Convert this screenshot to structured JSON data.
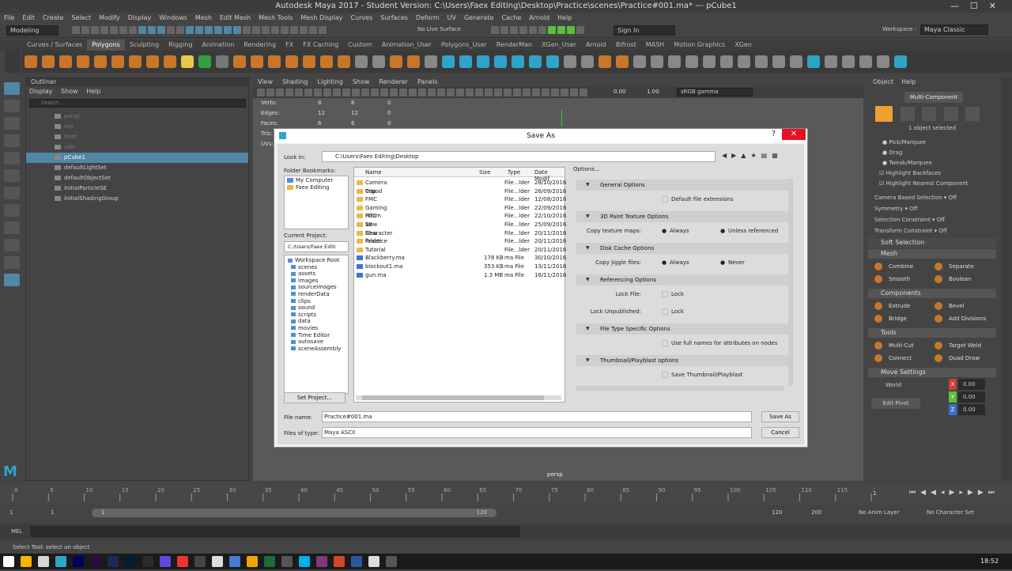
{
  "window": {
    "title": "Autodesk Maya 2017 - Student Version: C:\\Users\\Faex Editing\\Desktop\\Practice\\scenes\\Practice#001.ma*  ---  pCube1",
    "controls": [
      "—",
      "☐",
      "✕"
    ]
  },
  "menubar": [
    "File",
    "Edit",
    "Create",
    "Select",
    "Modify",
    "Display",
    "Windows",
    "Mesh",
    "Edit Mesh",
    "Mesh Tools",
    "Mesh Display",
    "Curves",
    "Surfaces",
    "Deform",
    "UV",
    "Generate",
    "Cache",
    "Arnold",
    "Help"
  ],
  "workspace": {
    "label": "Workspace :",
    "value": "Maya Classic"
  },
  "status": {
    "mode": "Modeling",
    "live": "No Live Surface",
    "signin": "Sign In"
  },
  "shelf_tabs": [
    "Curves / Surfaces",
    "Polygons",
    "Sculpting",
    "Rigging",
    "Animation",
    "Rendering",
    "FX",
    "FX Caching",
    "Custom",
    "Animation_User",
    "Polygons_User",
    "RenderMan",
    "XGen_User",
    "Arnold",
    "Bifrost",
    "MASH",
    "Motion Graphics",
    "XGen"
  ],
  "shelf_active": "Polygons",
  "outliner": {
    "title": "Outliner",
    "menu": [
      "Display",
      "Show",
      "Help"
    ],
    "search_placeholder": "Search...",
    "items": [
      {
        "label": "persp",
        "state": "dim"
      },
      {
        "label": "top",
        "state": "dim"
      },
      {
        "label": "front",
        "state": "dim"
      },
      {
        "label": "side",
        "state": "dim"
      },
      {
        "label": "pCube1",
        "state": "sel"
      },
      {
        "label": "defaultLightSet",
        "state": ""
      },
      {
        "label": "defaultObjectSet",
        "state": ""
      },
      {
        "label": "initialParticleSE",
        "state": ""
      },
      {
        "label": "initialShadingGroup",
        "state": ""
      }
    ]
  },
  "viewport": {
    "menu": [
      "View",
      "Shading",
      "Lighting",
      "Show",
      "Renderer",
      "Panels"
    ],
    "exposure": "0.00",
    "gamma": "1.00",
    "colorspace": "sRGB gamma",
    "hud": [
      {
        "label": "Verts:",
        "a": "8",
        "b": "8",
        "c": "0"
      },
      {
        "label": "Edges:",
        "a": "12",
        "b": "12",
        "c": "0"
      },
      {
        "label": "Faces:",
        "a": "6",
        "b": "6",
        "c": "0"
      },
      {
        "label": "Tris:",
        "a": "",
        "b": "",
        "c": ""
      },
      {
        "label": "UVs:",
        "a": "",
        "b": "",
        "c": ""
      }
    ],
    "camera": "persp"
  },
  "dialog": {
    "title": "Save As",
    "look_in_label": "Look in:",
    "look_in": "C:\\Users\\Faex Editing\\Desktop",
    "bookmarks_label": "Folder Bookmarks:",
    "bookmarks": [
      "My Computer",
      "Faex Editing"
    ],
    "project_label": "Current Project:",
    "project": "C:/Users/Faex Editi",
    "project_tree": [
      "Workspace Root",
      "scenes",
      "assets",
      "images",
      "sourceimages",
      "renderData",
      "clips",
      "sound",
      "scripts",
      "data",
      "movies",
      "Time Editor",
      "autosave",
      "sceneAssembly"
    ],
    "set_project": "Set Project...",
    "columns": [
      "Name",
      "Size",
      "Type",
      "Date Modif"
    ],
    "files": [
      {
        "name": "Camera Tripod",
        "size": "",
        "type": "File...lder",
        "date": "28/10/2016",
        "kind": "folder"
      },
      {
        "name": "Cop",
        "size": "",
        "type": "File...lder",
        "date": "26/09/2016",
        "kind": "folder"
      },
      {
        "name": "FMC",
        "size": "",
        "type": "File...lder",
        "date": "12/08/2016",
        "kind": "folder"
      },
      {
        "name": "Gaming Room",
        "size": "",
        "type": "File...lder",
        "date": "22/09/2016",
        "kind": "folder"
      },
      {
        "name": "HTC 10",
        "size": "",
        "type": "File...lder",
        "date": "22/10/2016",
        "kind": "folder"
      },
      {
        "name": "New Character",
        "size": "",
        "type": "File...lder",
        "date": "25/09/2016",
        "kind": "folder"
      },
      {
        "name": "New folder",
        "size": "",
        "type": "File...lder",
        "date": "20/11/2016",
        "kind": "folder"
      },
      {
        "name": "Practice",
        "size": "",
        "type": "File...lder",
        "date": "20/11/2016",
        "kind": "folder"
      },
      {
        "name": "Tutorial",
        "size": "",
        "type": "File...lder",
        "date": "20/11/2016",
        "kind": "folder"
      },
      {
        "name": "Blackberry.ma",
        "size": "178 KB",
        "type": "ma File",
        "date": "30/10/2016",
        "kind": "file"
      },
      {
        "name": "blockout1.ma",
        "size": "353 KB",
        "type": "ma File",
        "date": "13/11/2016",
        "kind": "file"
      },
      {
        "name": "gun.ma",
        "size": "1.3 MB",
        "type": "ma File",
        "date": "16/11/2016",
        "kind": "file"
      }
    ],
    "options_label": "Options...",
    "sections": [
      {
        "title": "General Options",
        "rows": [
          {
            "text": "Default file extensions",
            "kind": "check"
          }
        ]
      },
      {
        "title": "3D Paint Texture Options",
        "rows": [
          {
            "text": "Copy texture maps:",
            "opt1": "Always",
            "opt2": "Unless referenced",
            "kind": "radio"
          }
        ]
      },
      {
        "title": "Disk Cache Options",
        "rows": [
          {
            "text": "Copy jiggle files:",
            "opt1": "Always",
            "opt2": "Never",
            "kind": "radio"
          }
        ]
      },
      {
        "title": "Referencing Options",
        "rows": [
          {
            "text": "Lock File:",
            "opt1": "Lock",
            "kind": "lock"
          },
          {
            "text": "Lock Unpublished:",
            "opt1": "Lock",
            "kind": "lock"
          }
        ]
      },
      {
        "title": "File Type Specific Options",
        "rows": [
          {
            "text": "Use full names for attributes on nodes",
            "kind": "check"
          }
        ]
      },
      {
        "title": "Thumbnail/Playblast options",
        "rows": [
          {
            "text": "Save Thumbnail/Playblast",
            "kind": "check"
          }
        ]
      }
    ],
    "file_name_label": "File name:",
    "file_name": "Practice#001.ma",
    "file_type_label": "Files of type:",
    "file_type": "Maya ASCII",
    "save_btn": "Save As",
    "cancel_btn": "Cancel"
  },
  "right_panel": {
    "tabs": [
      "Object",
      "Help"
    ],
    "mode": "Multi-Component",
    "selected": "1 object selected",
    "pick_options": [
      "Pick/Marquee",
      "Drag",
      "Tweak/Marquee"
    ],
    "checks": [
      "Highlight Backfaces",
      "Highlight Nearest Component"
    ],
    "camera_sel": {
      "label": "Camera Based Selection",
      "value": "Off"
    },
    "symmetry": {
      "label": "Symmetry",
      "value": "Off"
    },
    "sel_constraint": {
      "label": "Selection Constraint",
      "value": "Off"
    },
    "transform_constraint": {
      "label": "Transform Constraint",
      "value": "Off"
    },
    "soft": "Soft Selection",
    "mesh_title": "Mesh",
    "mesh_btns": [
      "Combine",
      "Separate",
      "Smooth",
      "Boolean"
    ],
    "comp_title": "Components",
    "comp_btns": [
      "Extrude",
      "Bevel",
      "Bridge",
      "Add Divisions"
    ],
    "tools_title": "Tools",
    "tools_btns": [
      "Multi-Cut",
      "Target Weld",
      "Connect",
      "Quad Draw"
    ],
    "move_title": "Move Settings",
    "world": "World",
    "edit_pivot": "Edit Pivot",
    "xyz": [
      {
        "axis": "X",
        "val": "0.00",
        "color": "#d13b3b"
      },
      {
        "axis": "Y",
        "val": "0.00",
        "color": "#5dbf3a"
      },
      {
        "axis": "Z",
        "val": "0.00",
        "color": "#3b6fd1"
      }
    ]
  },
  "timeline": {
    "ticks": [
      "0",
      "5",
      "10",
      "15",
      "20",
      "25",
      "30",
      "35",
      "40",
      "45",
      "50",
      "55",
      "60",
      "65",
      "70",
      "75",
      "80",
      "85",
      "90",
      "95",
      "100",
      "105",
      "110",
      "115",
      "120"
    ],
    "current": "1"
  },
  "range": {
    "start": "1",
    "inner_start": "1",
    "inner_end": "120",
    "end_a": "120",
    "end_b": "200",
    "anim_layer": "No Anim Layer",
    "char_set": "No Character Set"
  },
  "mel": "MEL",
  "help_line": "Select Tool: select an object",
  "clock": "18:52"
}
